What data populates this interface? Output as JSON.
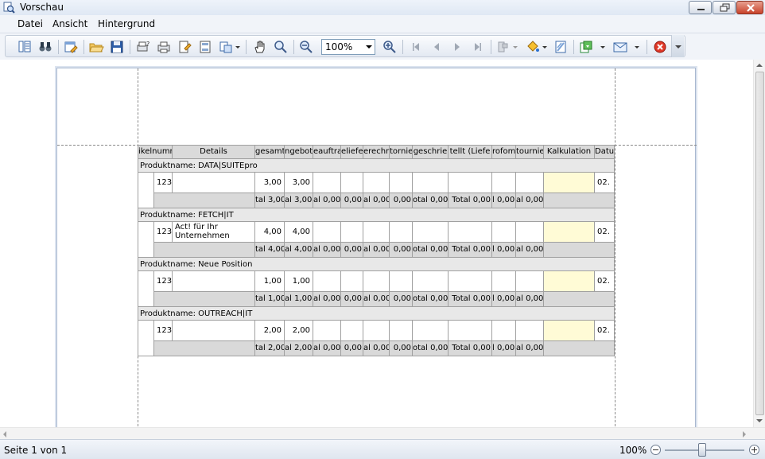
{
  "window": {
    "title": "Vorschau"
  },
  "menu": [
    "Datei",
    "Ansicht",
    "Hintergrund"
  ],
  "toolbar": {
    "zoom_value": "100%"
  },
  "report": {
    "headers": [
      "ikelnumr",
      "Details",
      "gesamt",
      "ngebote",
      "eauftra",
      "eliefe",
      "erechn",
      "tornie",
      "geschrie",
      "tellt (Liefe",
      "rofom",
      "tournie",
      "Kalkulation",
      "Datur"
    ],
    "groups": [
      {
        "label": "Produktname: DATA|SUITEpro",
        "row": {
          "artikel": "123",
          "details": "",
          "gesamt": "3,00",
          "angebote": "3,00",
          "datum": "02."
        },
        "totals": [
          "tal 3,00",
          "al 3,00",
          "al 0,00",
          "0,00",
          "al 0,00",
          "0,00",
          "otal 0,00",
          "Total 0,00",
          "l 0,00",
          "al 0,00"
        ]
      },
      {
        "label": "Produktname: FETCH|IT",
        "row": {
          "artikel": "123",
          "details": "Act! für Ihr Unternehmen",
          "gesamt": "4,00",
          "angebote": "4,00",
          "datum": "02."
        },
        "totals": [
          "tal 4,00",
          "al 4,00",
          "al 0,00",
          "0,00",
          "al 0,00",
          "0,00",
          "otal 0,00",
          "Total 0,00",
          "l 0,00",
          "al 0,00"
        ]
      },
      {
        "label": "Produktname: Neue Position",
        "row": {
          "artikel": "123",
          "details": "",
          "gesamt": "1,00",
          "angebote": "1,00",
          "datum": "02."
        },
        "totals": [
          "tal 1,00",
          "al 1,00",
          "al 0,00",
          "0,00",
          "al 0,00",
          "0,00",
          "otal 0,00",
          "Total 0,00",
          "l 0,00",
          "al 0,00"
        ]
      },
      {
        "label": "Produktname: OUTREACH|IT",
        "row": {
          "artikel": "123",
          "details": "",
          "gesamt": "2,00",
          "angebote": "2,00",
          "datum": "02."
        },
        "totals": [
          "tal 2,00",
          "al 2,00",
          "al 0,00",
          "0,00",
          "al 0,00",
          "0,00",
          "otal 0,00",
          "Total 0,00",
          "l 0,00",
          "al 0,00"
        ]
      }
    ]
  },
  "status": {
    "page_text": "Seite 1 von 1",
    "zoom_text": "100%",
    "zoom_fraction": 0.47
  },
  "colors": {
    "kalkulation_bg": "#fffbd6",
    "header_bg": "#dadada",
    "group_bg": "#e8e8e8"
  }
}
